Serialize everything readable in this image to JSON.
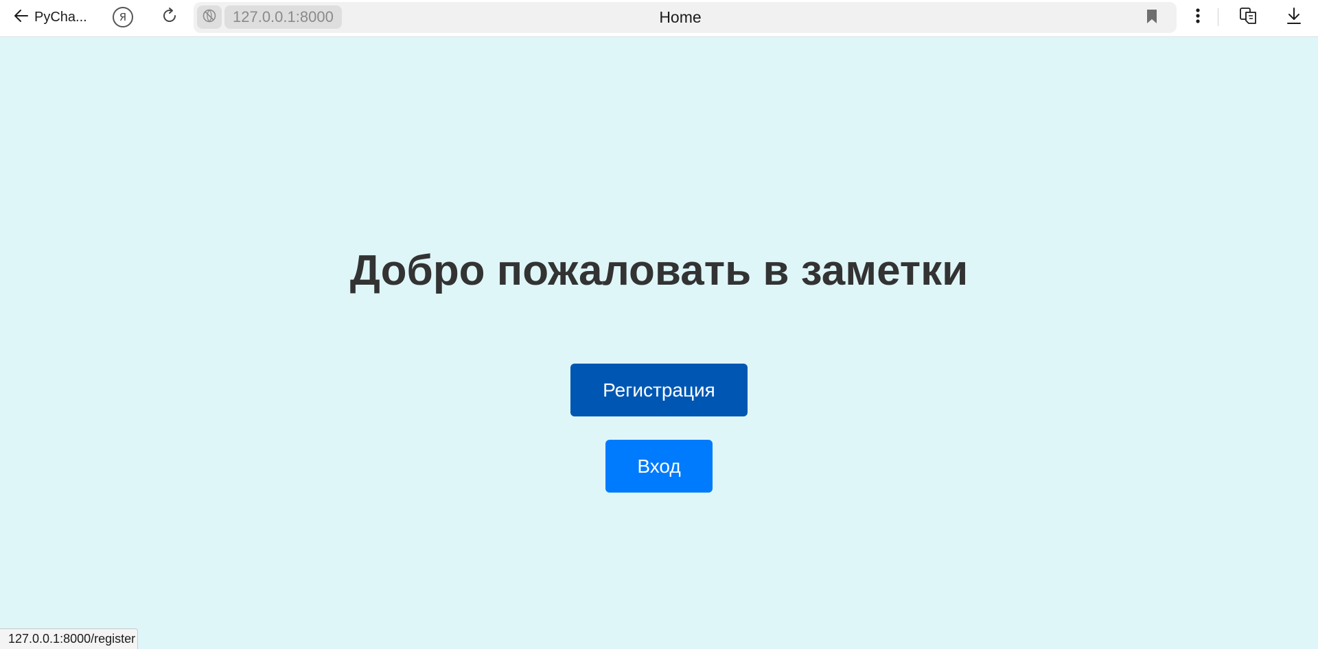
{
  "browser": {
    "back_label": "PyCha...",
    "yandex_glyph": "Я",
    "url": "127.0.0.1:8000",
    "page_title": "Home",
    "status_url": "127.0.0.1:8000/register",
    "icons": {
      "back": "arrow-left-icon",
      "yandex": "yandex-icon",
      "reload": "reload-icon",
      "site": "site-info-icon",
      "bookmark": "bookmark-icon",
      "menu": "more-vertical-icon",
      "translate": "translate-icon",
      "download": "download-icon"
    }
  },
  "page": {
    "heading": "Добро пожаловать в заметки",
    "register_label": "Регистрация",
    "login_label": "Вход"
  },
  "colors": {
    "background": "#dff6f8",
    "heading_text": "#333333",
    "register_button": "#0057b3",
    "login_button": "#007bfd"
  }
}
